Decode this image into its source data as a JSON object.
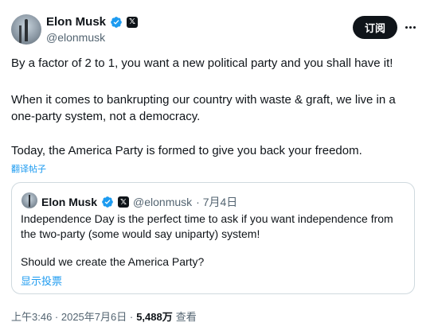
{
  "author": {
    "name": "Elon Musk",
    "handle": "@elonmusk",
    "badge_letter": "𝕏"
  },
  "subscribe_label": "订阅",
  "post_lines": [
    "By a factor of 2 to 1, you want a new political party and you shall have it!",
    "When it comes to bankrupting our country with waste & graft, we live in a",
    "one-party system, not a democracy.",
    "Today, the America Party is formed to give you back your freedom."
  ],
  "translate_label": "翻译帖子",
  "quote": {
    "name": "Elon Musk",
    "handle": "@elonmusk",
    "date": "· 7月4日",
    "lines": [
      "Independence Day is the perfect time to ask if you want independence from",
      "the two-party (some would say uniparty) system!",
      "Should we create the America Party?"
    ],
    "show_poll_label": "显示投票"
  },
  "meta": {
    "time": "上午3:46 · 2025年7月6日 ·",
    "views_count": "5,488万",
    "views_label": "查看"
  },
  "colors": {
    "accent": "#1d9bf0",
    "text": "#0f1419",
    "secondary": "#536471",
    "border": "#cfd9de"
  }
}
